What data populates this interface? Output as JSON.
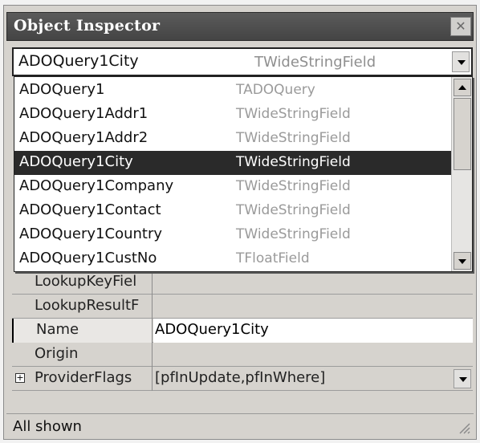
{
  "window": {
    "title": "Object Inspector",
    "close_glyph": "✕"
  },
  "selector": {
    "selected_name": "ADOQuery1City",
    "selected_type": "TWideStringField"
  },
  "dropdown": {
    "items": [
      {
        "name": "ADOQuery1",
        "type": "TADOQuery"
      },
      {
        "name": "ADOQuery1Addr1",
        "type": "TWideStringField"
      },
      {
        "name": "ADOQuery1Addr2",
        "type": "TWideStringField"
      },
      {
        "name": "ADOQuery1City",
        "type": "TWideStringField"
      },
      {
        "name": "ADOQuery1Company",
        "type": "TWideStringField"
      },
      {
        "name": "ADOQuery1Contact",
        "type": "TWideStringField"
      },
      {
        "name": "ADOQuery1Country",
        "type": "TWideStringField"
      },
      {
        "name": "ADOQuery1CustNo",
        "type": "TFloatField"
      }
    ],
    "selected_index": 3
  },
  "properties": [
    {
      "name": "LookupKeyFiel",
      "value": ""
    },
    {
      "name": "LookupResultF",
      "value": ""
    },
    {
      "name": "Name",
      "value": "ADOQuery1City"
    },
    {
      "name": "Origin",
      "value": ""
    },
    {
      "name": "ProviderFlags",
      "value": "[pfInUpdate,pfInWhere]"
    }
  ],
  "status": {
    "text": "All shown"
  },
  "colors": {
    "window_bg": "#d6d3ce",
    "titlebar": "#444444",
    "selection": "#2a2a2a",
    "type_text": "#9a9a9a"
  }
}
